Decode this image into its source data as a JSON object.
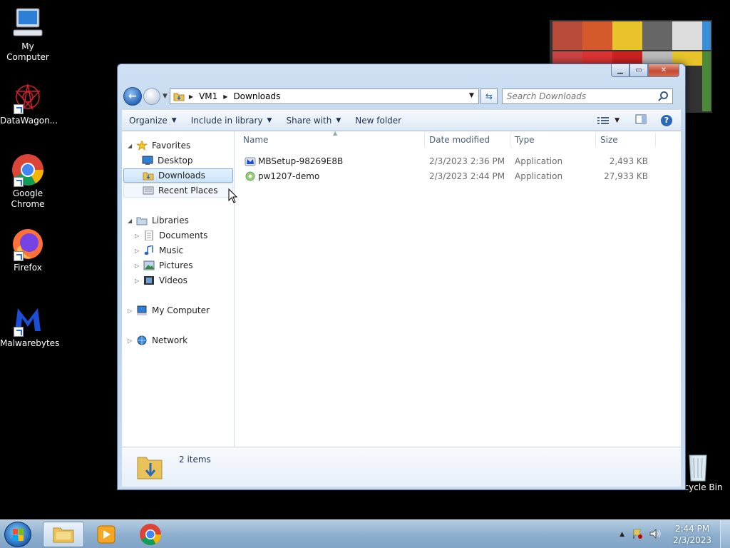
{
  "desktop": {
    "icons": [
      {
        "label": "My Computer",
        "icon": "computer-icon"
      },
      {
        "label": "DataWagon...",
        "icon": "datawagon-icon"
      },
      {
        "label": "Google Chrome",
        "icon": "chrome-icon"
      },
      {
        "label": "Firefox",
        "icon": "firefox-icon"
      },
      {
        "label": "Malwarebytes",
        "icon": "malwarebytes-icon"
      }
    ],
    "recycle_bin": "Recycle Bin"
  },
  "window": {
    "breadcrumb": [
      "VM1",
      "Downloads"
    ],
    "search_placeholder": "Search Downloads",
    "toolbar": {
      "organize": "Organize",
      "include_in_library": "Include in library",
      "share_with": "Share with",
      "new_folder": "New folder"
    },
    "nav": {
      "favorites": "Favorites",
      "desktop": "Desktop",
      "downloads": "Downloads",
      "recent_places": "Recent Places",
      "libraries": "Libraries",
      "documents": "Documents",
      "music": "Music",
      "pictures": "Pictures",
      "videos": "Videos",
      "my_computer": "My Computer",
      "network": "Network"
    },
    "columns": {
      "name": "Name",
      "date_modified": "Date modified",
      "type": "Type",
      "size": "Size"
    },
    "files": [
      {
        "name": "MBSetup-98269E8B",
        "date": "2/3/2023 2:36 PM",
        "type": "Application",
        "size": "2,493 KB"
      },
      {
        "name": "pw1207-demo",
        "date": "2/3/2023 2:44 PM",
        "type": "Application",
        "size": "27,933 KB"
      }
    ],
    "status": "2 items"
  },
  "taskbar": {
    "time": "2:44 PM",
    "date": "2/3/2023"
  },
  "colors": {
    "selection": "#cde4fb",
    "accent": "#2a67b8",
    "close_button": "#c44a31"
  }
}
